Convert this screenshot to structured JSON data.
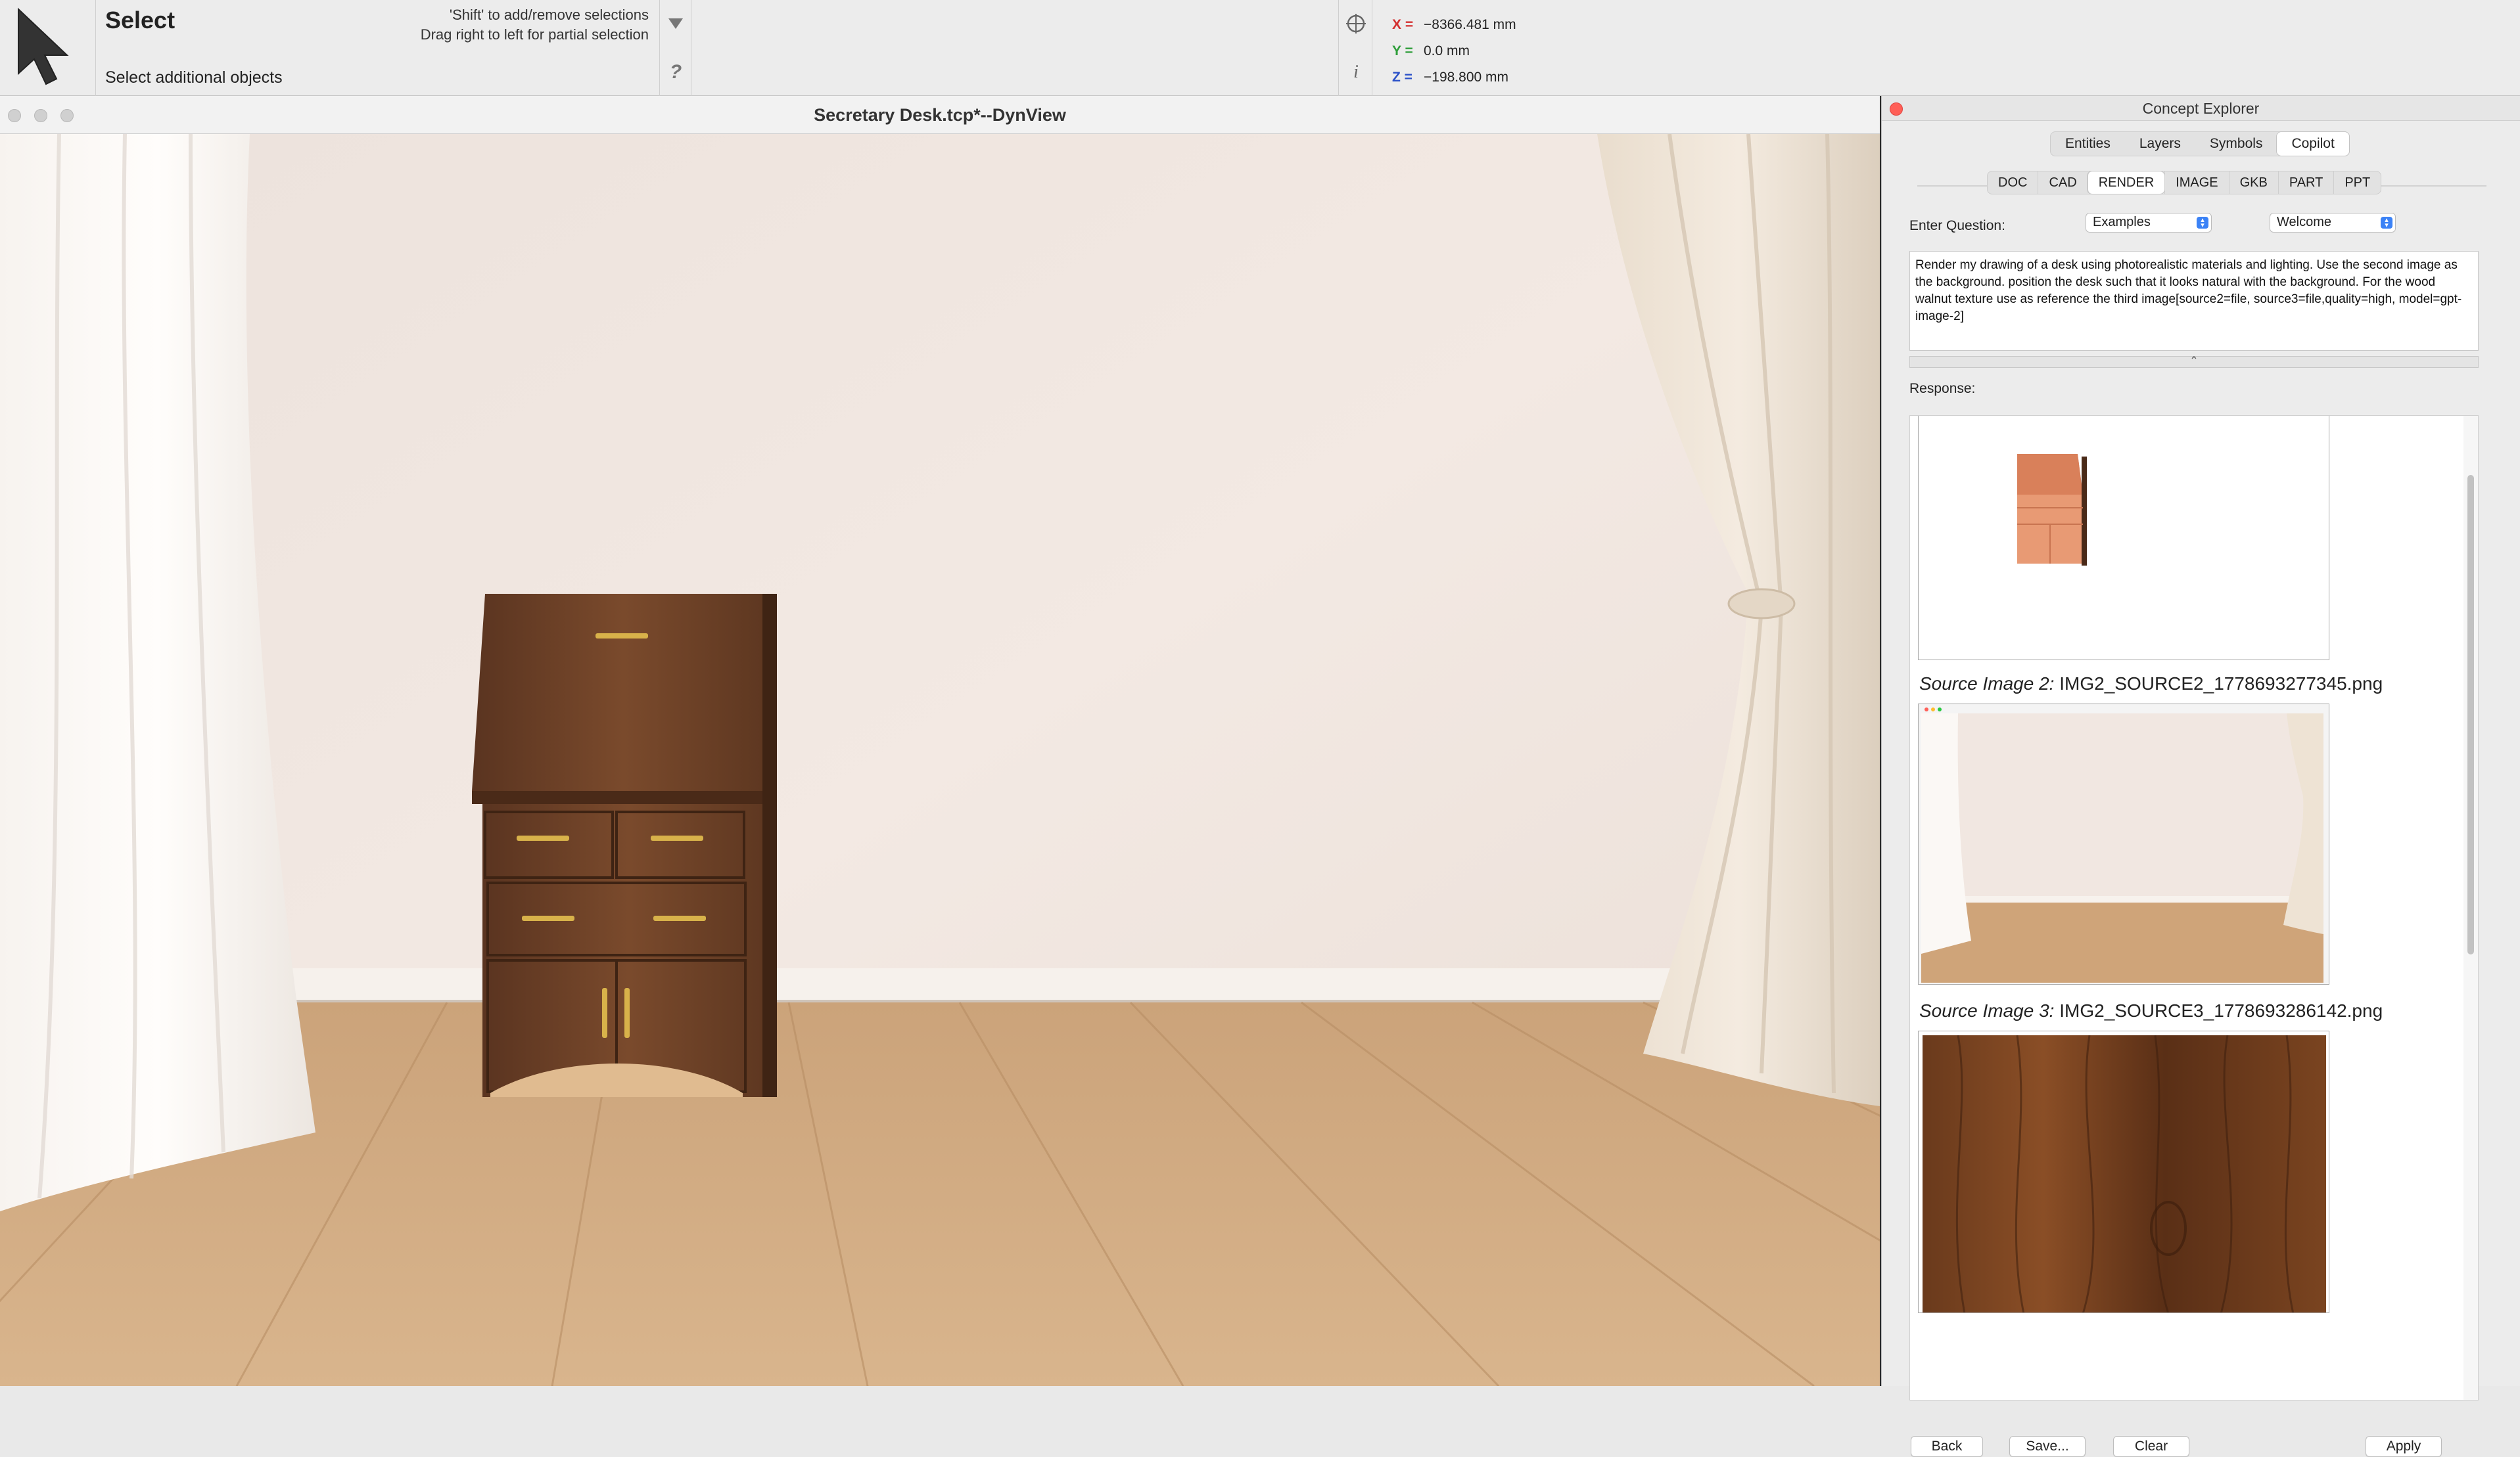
{
  "toolbar": {
    "tool_title": "Select",
    "hint_line1": "'Shift' to add/remove selections",
    "hint_line2": "Drag right to left for partial selection",
    "subtitle": "Select additional objects",
    "help_label": "?",
    "info_label": "i"
  },
  "coordinates": {
    "x_label": "X =",
    "x_value": "−8366.481 mm",
    "y_label": "Y =",
    "y_value": "0.0 mm",
    "z_label": "Z =",
    "z_value": "−198.800 mm",
    "x_color": "#d32f2f",
    "y_color": "#2e9e3a",
    "z_color": "#2a50c8"
  },
  "dynview": {
    "title": "Secretary Desk.tcp*--DynView"
  },
  "explorer": {
    "title": "Concept Explorer",
    "tabs": [
      {
        "label": "Entities"
      },
      {
        "label": "Layers"
      },
      {
        "label": "Symbols"
      },
      {
        "label": "Copilot"
      }
    ],
    "subtabs": [
      {
        "label": "DOC"
      },
      {
        "label": "CAD"
      },
      {
        "label": "RENDER"
      },
      {
        "label": "IMAGE"
      },
      {
        "label": "GKB"
      },
      {
        "label": "PART"
      },
      {
        "label": "PPT"
      }
    ],
    "question_label": "Enter Question:",
    "examples_select": "Examples",
    "welcome_select": "Welcome",
    "prompt_text": "Render my drawing of a desk using photorealistic materials and lighting.  Use the second image as the background.  position the desk such that it looks natural with the background. For the wood walnut texture use as reference the third image[source2=file, source3=file,quality=high, model=gpt-image-2]",
    "splitter_label": "⌃",
    "response_label": "Response:",
    "source2_prefix": "Source Image 2:",
    "source2_name": "IMG2_SOURCE2_1778693277345.png",
    "source3_prefix": "Source Image 3:",
    "source3_name": "IMG2_SOURCE3_1778693286142.png",
    "buttons": {
      "back": "Back",
      "save": "Save...",
      "clear": "Clear",
      "apply": "Apply"
    }
  }
}
